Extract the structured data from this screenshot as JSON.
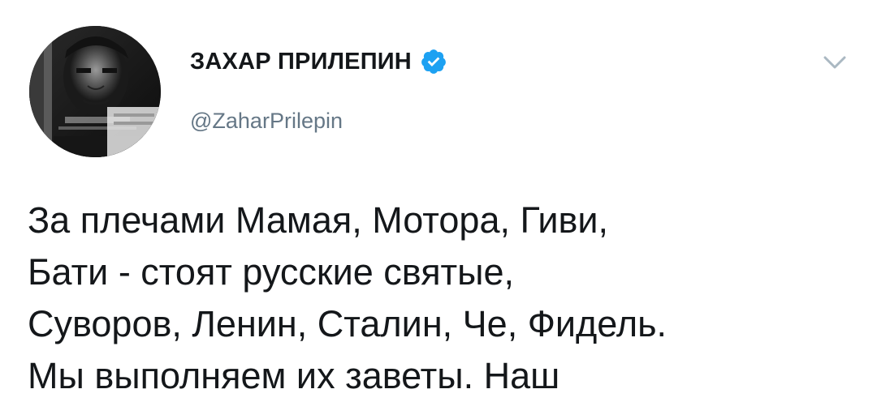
{
  "user": {
    "display_name": "ЗАХАР ПРИЛЕПИН",
    "handle": "@ZaharPrilepin",
    "verified": true
  },
  "tweet": {
    "lines": [
      "За плечами Мамая, Мотора, Гиви,",
      "Бати - стоят русские святые,",
      "Суворов, Ленин, Сталин, Че, Фидель.",
      "Мы выполняем их заветы. Наш"
    ]
  },
  "icons": {
    "verified": "verified-badge-icon",
    "menu": "chevron-down-icon"
  },
  "colors": {
    "text": "#14171a",
    "secondary": "#657786",
    "verified_blue": "#1da1f2",
    "caret": "#aab8c2"
  }
}
